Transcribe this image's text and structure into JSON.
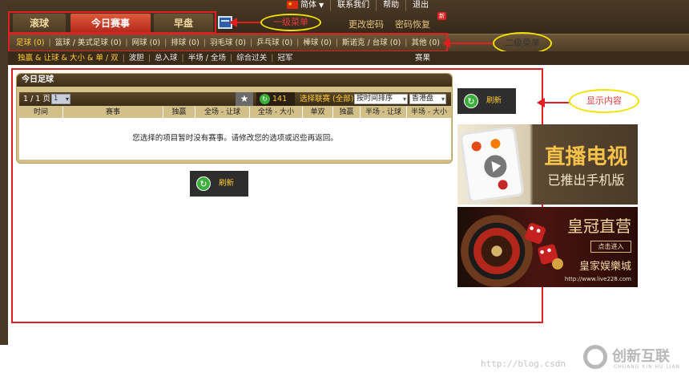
{
  "header": {
    "tabs": [
      {
        "label": "滚球"
      },
      {
        "label": "今日赛事"
      },
      {
        "label": "早盘"
      }
    ],
    "top_links": {
      "language": "简体",
      "contact": "联系我们",
      "help": "帮助",
      "logout": "退出"
    },
    "account": {
      "change_password": "更改密码",
      "recover_password": "密码恢复",
      "new_badge": "新"
    }
  },
  "annotations": {
    "level1_menu": "一级菜单",
    "level2_menu": "二级菜单",
    "content_display": "显示内容"
  },
  "sport_bar": {
    "items": [
      "足球 (0)",
      "篮球 / 美式足球 (0)",
      "网球 (0)",
      "排球 (0)",
      "羽毛球 (0)",
      "乒乓球 (0)",
      "棒球 (0)",
      "斯诺克 / 台球 (0)",
      "其他 (0)"
    ]
  },
  "bet_bar": {
    "items": [
      "独赢 & 让球 & 大小 & 单 / 双",
      "波胆",
      "总入球",
      "半场 / 全场",
      "综合过关",
      "冠军"
    ],
    "champion": "赛果"
  },
  "panel": {
    "title": "今日足球",
    "pager": "1 / 1 页",
    "page_value": "1",
    "refresh_count": "141",
    "select_league": "选择联赛 (全部)",
    "sort_value": "按时间排序",
    "odds_value": "香港盘",
    "columns": [
      "时间",
      "赛事",
      "独赢",
      "全场 - 让球",
      "全场 - 大小",
      "单双",
      "独赢",
      "半场 - 让球",
      "半场 - 大小"
    ],
    "empty_message": "您选择的项目暂时没有赛事。请修改您的选项或迟些再返回。"
  },
  "buttons": {
    "refresh": "刷新"
  },
  "ads": {
    "tv_title": "直播电视",
    "tv_subtitle": "已推出手机版",
    "casino_title": "皇冠直营",
    "casino_enter": "点击进入",
    "casino_brand": "皇家娱樂城",
    "casino_url": "http://www.live228.com"
  },
  "watermark": {
    "url": "http://blog.csdn",
    "brand": "创新互联",
    "brand_sub": "CHUANG XIN HU LIAN"
  },
  "colors": {
    "header_bg": "#4b3a26",
    "active_tab": "#d03a24",
    "accent_gold": "#ffcc33",
    "annotation_red": "#e02020",
    "annotation_yellow": "#f2e200"
  }
}
